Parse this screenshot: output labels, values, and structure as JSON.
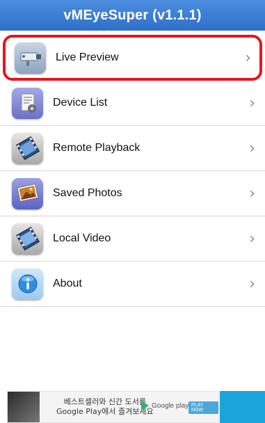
{
  "app": {
    "title": "vMEyeSuper (v1.1.1)"
  },
  "menu": {
    "items": [
      {
        "label": "Live Preview",
        "icon": "camera-icon"
      },
      {
        "label": "Device List",
        "icon": "device-list-icon"
      },
      {
        "label": "Remote Playback",
        "icon": "film-reel-icon"
      },
      {
        "label": "Saved Photos",
        "icon": "photos-icon"
      },
      {
        "label": "Local Video",
        "icon": "film-icon"
      },
      {
        "label": "About",
        "icon": "info-icon"
      }
    ],
    "chevron": "›",
    "highlight_color": "#e8141d"
  },
  "ad": {
    "line1": "베스트셀러와 신간 도서를",
    "line2": "Google Play에서 즐겨보세요",
    "store": "Google play",
    "button": "PLAY NOW"
  },
  "colors": {
    "header": "#3a7fd6",
    "divider": "#d7d7d7"
  }
}
